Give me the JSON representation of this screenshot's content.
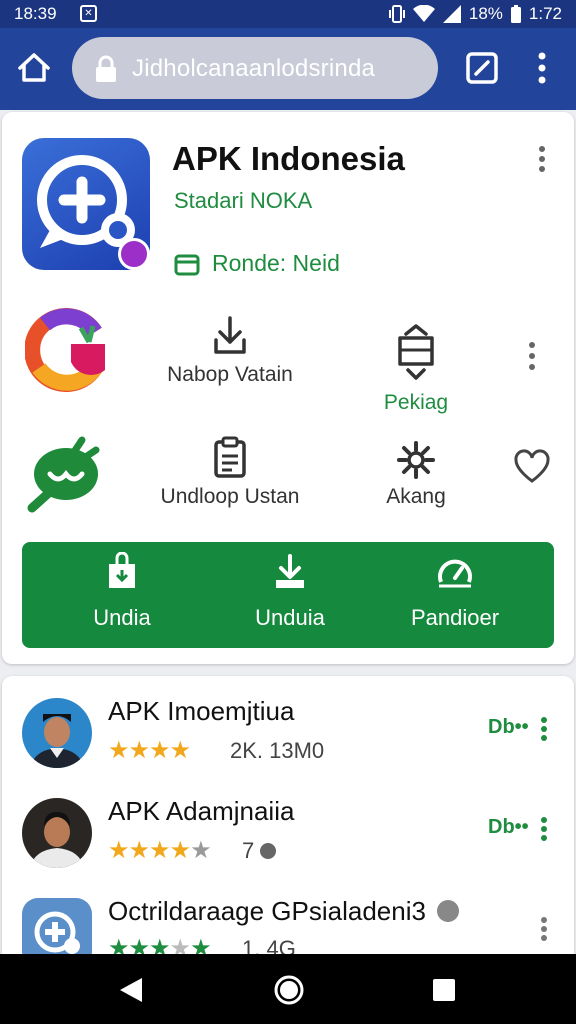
{
  "status_bar": {
    "time": "18:39",
    "battery": "18%",
    "clock": "1:72"
  },
  "browser": {
    "url": "Jidholcanaanlodsrinda"
  },
  "app": {
    "title": "APK Indonesia",
    "subtitle": "Stadari NOKA",
    "status": "Ronde: Neid",
    "grid": [
      {
        "label": "Nabop Vatain",
        "icon": "download-icon"
      },
      {
        "label": "Pekiag",
        "icon": "package-icon"
      },
      {
        "label": "Undloop Ustan",
        "icon": "clipboard-icon"
      },
      {
        "label": "Akang",
        "icon": "settings-gear-icon"
      }
    ],
    "actions": [
      {
        "label": "Undia",
        "icon": "install-bag-icon"
      },
      {
        "label": "Unduia",
        "icon": "download-tray-icon"
      },
      {
        "label": "Pandioer",
        "icon": "speedometer-icon"
      }
    ]
  },
  "list": [
    {
      "title": "APK Imoemjtiua",
      "meta": "2K. 13M0",
      "rating": 4,
      "action": "Db••"
    },
    {
      "title": "APK Adamjnaiia",
      "meta": "7",
      "rating": 4,
      "action": "Db••"
    },
    {
      "title": "Octrildaraage GPsialadeni3",
      "meta": "1. 4G",
      "rating": 3,
      "action": ""
    }
  ],
  "colors": {
    "brand_blue": "#22459b",
    "status_blue": "#1b3580",
    "green": "#158a3e",
    "star": "#f2a81d"
  }
}
